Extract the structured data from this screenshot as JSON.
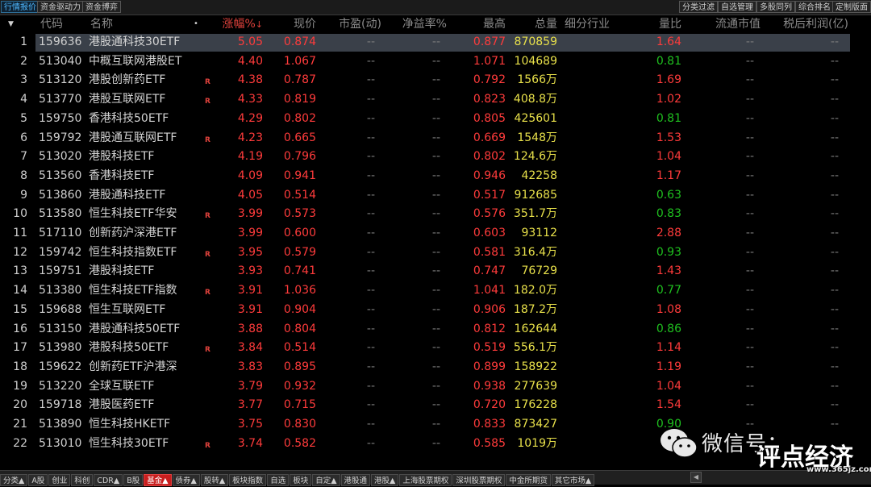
{
  "top_tabs": [
    {
      "label": "行情报价",
      "active": true
    },
    {
      "label": "资金驱动力",
      "active": false
    },
    {
      "label": "资金博弈",
      "active": false
    }
  ],
  "right_tabs": [
    "分类过滤",
    "自选管理",
    "多股同列",
    "综合排名",
    "定制版面"
  ],
  "header": {
    "index_marker": "▼",
    "code": "代码",
    "name": "名称",
    "dot": "•",
    "change": "涨幅%",
    "sort_arrow": "↓",
    "price": "现价",
    "pe_dynamic": "市盈(动)",
    "pb": "净益率%",
    "high": "最高",
    "volume": "总量",
    "industry": "细分行业",
    "vol_ratio": "量比",
    "float_mcap": "流通市值",
    "net_profit": "税后利润(亿)"
  },
  "colors": {
    "up": "#ff3b3b",
    "down": "#1fc11f",
    "volume": "#e8e04a"
  },
  "rows": [
    {
      "idx": "1",
      "code": "159636",
      "name": "港股通科技30ETF",
      "flag": "",
      "chg": "5.05",
      "price": "0.874",
      "pe": "--",
      "pb": "--",
      "high": "0.877",
      "vol": "870859",
      "ratio": "1.64",
      "ratio_dir": "up",
      "mcap": "--",
      "profit": "--",
      "selected": true
    },
    {
      "idx": "2",
      "code": "513040",
      "name": "中概互联网港股ET",
      "flag": "",
      "chg": "4.40",
      "price": "1.067",
      "pe": "--",
      "pb": "--",
      "high": "1.071",
      "vol": "104689",
      "ratio": "0.81",
      "ratio_dir": "down",
      "mcap": "--",
      "profit": "--"
    },
    {
      "idx": "3",
      "code": "513120",
      "name": "港股创新药ETF",
      "flag": "R",
      "chg": "4.38",
      "price": "0.787",
      "pe": "--",
      "pb": "--",
      "high": "0.792",
      "vol": "1566万",
      "ratio": "1.69",
      "ratio_dir": "up",
      "mcap": "--",
      "profit": "--"
    },
    {
      "idx": "4",
      "code": "513770",
      "name": "港股互联网ETF",
      "flag": "R",
      "chg": "4.33",
      "price": "0.819",
      "pe": "--",
      "pb": "--",
      "high": "0.823",
      "vol": "408.8万",
      "ratio": "1.02",
      "ratio_dir": "up",
      "mcap": "--",
      "profit": "--"
    },
    {
      "idx": "5",
      "code": "159750",
      "name": "香港科技50ETF",
      "flag": "",
      "chg": "4.29",
      "price": "0.802",
      "pe": "--",
      "pb": "--",
      "high": "0.805",
      "vol": "425601",
      "ratio": "0.81",
      "ratio_dir": "down",
      "mcap": "--",
      "profit": "--"
    },
    {
      "idx": "6",
      "code": "159792",
      "name": "港股通互联网ETF",
      "flag": "R",
      "chg": "4.23",
      "price": "0.665",
      "pe": "--",
      "pb": "--",
      "high": "0.669",
      "vol": "1548万",
      "ratio": "1.53",
      "ratio_dir": "up",
      "mcap": "--",
      "profit": "--"
    },
    {
      "idx": "7",
      "code": "513020",
      "name": "港股科技ETF",
      "flag": "",
      "chg": "4.19",
      "price": "0.796",
      "pe": "--",
      "pb": "--",
      "high": "0.802",
      "vol": "124.6万",
      "ratio": "1.04",
      "ratio_dir": "up",
      "mcap": "--",
      "profit": "--"
    },
    {
      "idx": "8",
      "code": "513560",
      "name": "香港科技ETF",
      "flag": "",
      "chg": "4.09",
      "price": "0.941",
      "pe": "--",
      "pb": "--",
      "high": "0.946",
      "vol": "42258",
      "ratio": "1.17",
      "ratio_dir": "up",
      "mcap": "--",
      "profit": "--"
    },
    {
      "idx": "9",
      "code": "513860",
      "name": "港股通科技ETF",
      "flag": "",
      "chg": "4.05",
      "price": "0.514",
      "pe": "--",
      "pb": "--",
      "high": "0.517",
      "vol": "912685",
      "ratio": "0.63",
      "ratio_dir": "down",
      "mcap": "--",
      "profit": "--"
    },
    {
      "idx": "10",
      "code": "513580",
      "name": "恒生科技ETF华安",
      "flag": "R",
      "chg": "3.99",
      "price": "0.573",
      "pe": "--",
      "pb": "--",
      "high": "0.576",
      "vol": "351.7万",
      "ratio": "0.83",
      "ratio_dir": "down",
      "mcap": "--",
      "profit": "--"
    },
    {
      "idx": "11",
      "code": "517110",
      "name": "创新药沪深港ETF",
      "flag": "",
      "chg": "3.99",
      "price": "0.600",
      "pe": "--",
      "pb": "--",
      "high": "0.603",
      "vol": "93112",
      "ratio": "2.88",
      "ratio_dir": "up",
      "mcap": "--",
      "profit": "--"
    },
    {
      "idx": "12",
      "code": "159742",
      "name": "恒生科技指数ETF",
      "flag": "R",
      "chg": "3.95",
      "price": "0.579",
      "pe": "--",
      "pb": "--",
      "high": "0.581",
      "vol": "316.4万",
      "ratio": "0.93",
      "ratio_dir": "down",
      "mcap": "--",
      "profit": "--"
    },
    {
      "idx": "13",
      "code": "159751",
      "name": "港股科技ETF",
      "flag": "",
      "chg": "3.93",
      "price": "0.741",
      "pe": "--",
      "pb": "--",
      "high": "0.747",
      "vol": "76729",
      "ratio": "1.43",
      "ratio_dir": "up",
      "mcap": "--",
      "profit": "--"
    },
    {
      "idx": "14",
      "code": "513380",
      "name": "恒生科技ETF指数",
      "flag": "R",
      "chg": "3.91",
      "price": "1.036",
      "pe": "--",
      "pb": "--",
      "high": "1.041",
      "vol": "182.0万",
      "ratio": "0.77",
      "ratio_dir": "down",
      "mcap": "--",
      "profit": "--"
    },
    {
      "idx": "15",
      "code": "159688",
      "name": "恒生互联网ETF",
      "flag": "",
      "chg": "3.91",
      "price": "0.904",
      "pe": "--",
      "pb": "--",
      "high": "0.906",
      "vol": "187.2万",
      "ratio": "1.08",
      "ratio_dir": "up",
      "mcap": "--",
      "profit": "--"
    },
    {
      "idx": "16",
      "code": "513150",
      "name": "港股通科技50ETF",
      "flag": "",
      "chg": "3.88",
      "price": "0.804",
      "pe": "--",
      "pb": "--",
      "high": "0.812",
      "vol": "162644",
      "ratio": "0.86",
      "ratio_dir": "down",
      "mcap": "--",
      "profit": "--"
    },
    {
      "idx": "17",
      "code": "513980",
      "name": "港股科技50ETF",
      "flag": "R",
      "chg": "3.84",
      "price": "0.514",
      "pe": "--",
      "pb": "--",
      "high": "0.519",
      "vol": "556.1万",
      "ratio": "1.14",
      "ratio_dir": "up",
      "mcap": "--",
      "profit": "--"
    },
    {
      "idx": "18",
      "code": "159622",
      "name": "创新药ETF沪港深",
      "flag": "",
      "chg": "3.83",
      "price": "0.895",
      "pe": "--",
      "pb": "--",
      "high": "0.899",
      "vol": "158922",
      "ratio": "1.19",
      "ratio_dir": "up",
      "mcap": "--",
      "profit": "--"
    },
    {
      "idx": "19",
      "code": "513220",
      "name": "全球互联ETF",
      "flag": "",
      "chg": "3.79",
      "price": "0.932",
      "pe": "--",
      "pb": "--",
      "high": "0.938",
      "vol": "277639",
      "ratio": "1.04",
      "ratio_dir": "up",
      "mcap": "--",
      "profit": "--"
    },
    {
      "idx": "20",
      "code": "159718",
      "name": "港股医药ETF",
      "flag": "",
      "chg": "3.77",
      "price": "0.715",
      "pe": "--",
      "pb": "--",
      "high": "0.720",
      "vol": "176228",
      "ratio": "1.54",
      "ratio_dir": "up",
      "mcap": "--",
      "profit": "--"
    },
    {
      "idx": "21",
      "code": "513890",
      "name": "恒生科技HKETF",
      "flag": "",
      "chg": "3.75",
      "price": "0.830",
      "pe": "--",
      "pb": "--",
      "high": "0.833",
      "vol": "873427",
      "ratio": "0.90",
      "ratio_dir": "down",
      "mcap": "--",
      "profit": "--"
    },
    {
      "idx": "22",
      "code": "513010",
      "name": "恒生科技30ETF",
      "flag": "R",
      "chg": "3.74",
      "price": "0.582",
      "pe": "--",
      "pb": "--",
      "high": "0.585",
      "vol": "1019万",
      "ratio": "",
      "ratio_dir": "up",
      "mcap": "",
      "profit": ""
    }
  ],
  "bottom_tabs": [
    {
      "label": "分类▲",
      "active": false
    },
    {
      "label": "A股",
      "active": false
    },
    {
      "label": "创业",
      "active": false
    },
    {
      "label": "科创",
      "active": false
    },
    {
      "label": "CDR▲",
      "active": false
    },
    {
      "label": "B股",
      "active": false
    },
    {
      "label": "基金▲",
      "active": true
    },
    {
      "label": "债券▲",
      "active": false
    },
    {
      "label": "股转▲",
      "active": false
    },
    {
      "label": "板块指数",
      "active": false
    },
    {
      "label": "自选",
      "active": false
    },
    {
      "label": "板块",
      "active": false
    },
    {
      "label": "自定▲",
      "active": false
    },
    {
      "label": "港股通",
      "active": false
    },
    {
      "label": "港股▲",
      "active": false
    },
    {
      "label": "上海股票期权",
      "active": false
    },
    {
      "label": "深圳股票期权",
      "active": false
    },
    {
      "label": "中金所期货",
      "active": false
    },
    {
      "label": "其它市场▲",
      "active": false
    }
  ],
  "watermark": {
    "line1": "微信号：",
    "line2": "评点经济",
    "url": "www.365jz.com"
  }
}
